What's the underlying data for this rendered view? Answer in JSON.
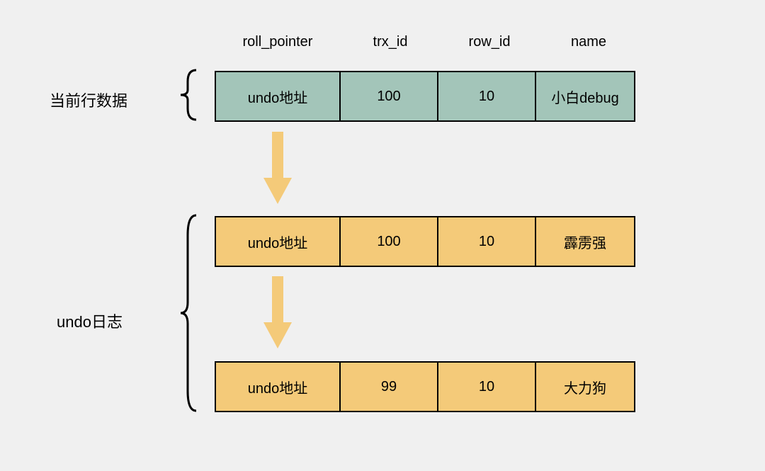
{
  "headers": {
    "col1": "roll_pointer",
    "col2": "trx_id",
    "col3": "row_id",
    "col4": "name"
  },
  "labels": {
    "current_row": "当前行数据",
    "undo_log": "undo日志"
  },
  "rows": [
    {
      "roll_pointer": "undo地址",
      "trx_id": "100",
      "row_id": "10",
      "name": "小白debug",
      "color": "teal"
    },
    {
      "roll_pointer": "undo地址",
      "trx_id": "100",
      "row_id": "10",
      "name": "霹雳强",
      "color": "yellow"
    },
    {
      "roll_pointer": "undo地址",
      "trx_id": "99",
      "row_id": "10",
      "name": "大力狗",
      "color": "yellow"
    }
  ],
  "colors": {
    "teal": "#a3c5b9",
    "yellow": "#f4ca79",
    "arrow": "#f4ca79",
    "background": "#f0f0f0"
  }
}
